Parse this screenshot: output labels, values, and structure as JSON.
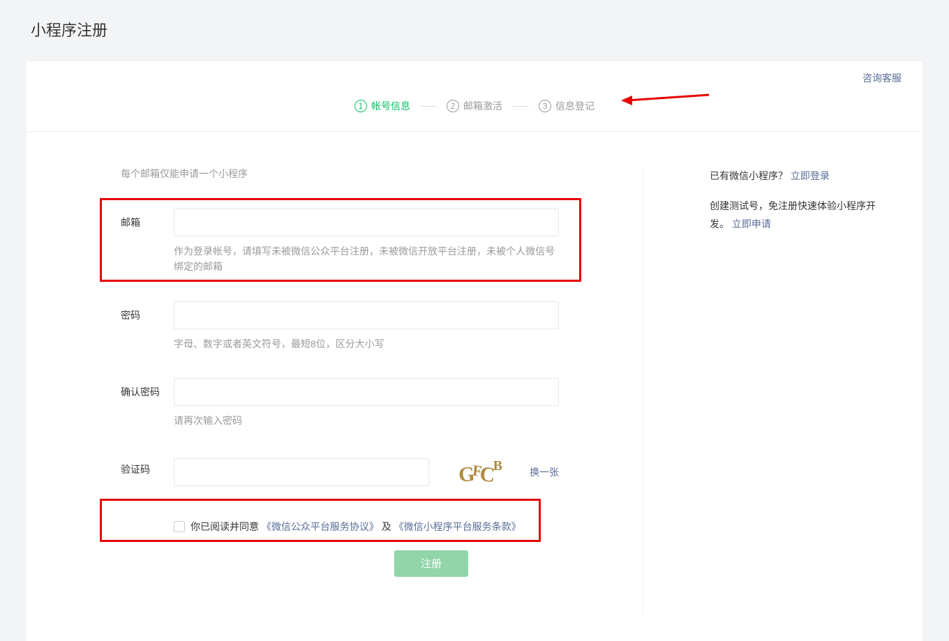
{
  "page": {
    "title": "小程序注册"
  },
  "supportLink": "咨询客服",
  "steps": [
    {
      "num": "①",
      "label": "帐号信息",
      "active": true
    },
    {
      "num": "②",
      "label": "邮箱激活",
      "active": false
    },
    {
      "num": "③",
      "label": "信息登记",
      "active": false
    }
  ],
  "form": {
    "topHint": "每个邮箱仅能申请一个小程序",
    "email": {
      "label": "邮箱",
      "help": "作为登录帐号，请填写未被微信公众平台注册，未被微信开放平台注册，未被个人微信号绑定的邮箱"
    },
    "password": {
      "label": "密码",
      "help": "字母、数字或者英文符号，最短8位，区分大小写"
    },
    "confirm": {
      "label": "确认密码",
      "help": "请再次输入密码"
    },
    "captcha": {
      "label": "验证码",
      "imageText": "GFCB",
      "refresh": "换一张"
    },
    "agreement": {
      "prefix": "你已阅读并同意",
      "link1": "《微信公众平台服务协议》",
      "mid": "及",
      "link2": "《微信小程序平台服务条款》"
    },
    "submit": "注册"
  },
  "side": {
    "existingPrefix": "已有微信小程序？",
    "loginLink": "立即登录",
    "testPrefix": "创建测试号，免注册快速体验小程序开发。",
    "applyLink": "立即申请"
  }
}
